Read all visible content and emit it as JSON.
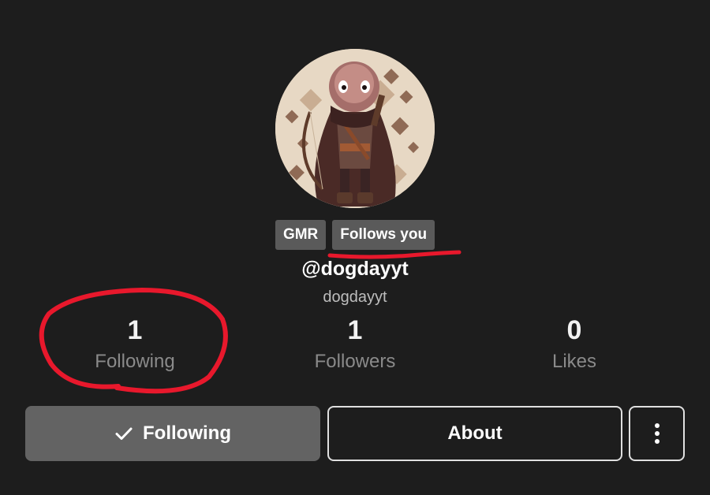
{
  "profile": {
    "badges": [
      "GMR",
      "Follows you"
    ],
    "handle": "@dogdayyt",
    "username": "dogdayyt"
  },
  "stats": {
    "following": {
      "count": "1",
      "label": "Following"
    },
    "followers": {
      "count": "1",
      "label": "Followers"
    },
    "likes": {
      "count": "0",
      "label": "Likes"
    }
  },
  "actions": {
    "following_label": "Following",
    "about_label": "About",
    "following_icon": "check-icon",
    "more_icon": "vertical-dots-icon"
  },
  "colors": {
    "background": "#1d1d1d",
    "badge": "#5a5a5a",
    "following_button": "#636363",
    "annotation": "#e8182c"
  }
}
